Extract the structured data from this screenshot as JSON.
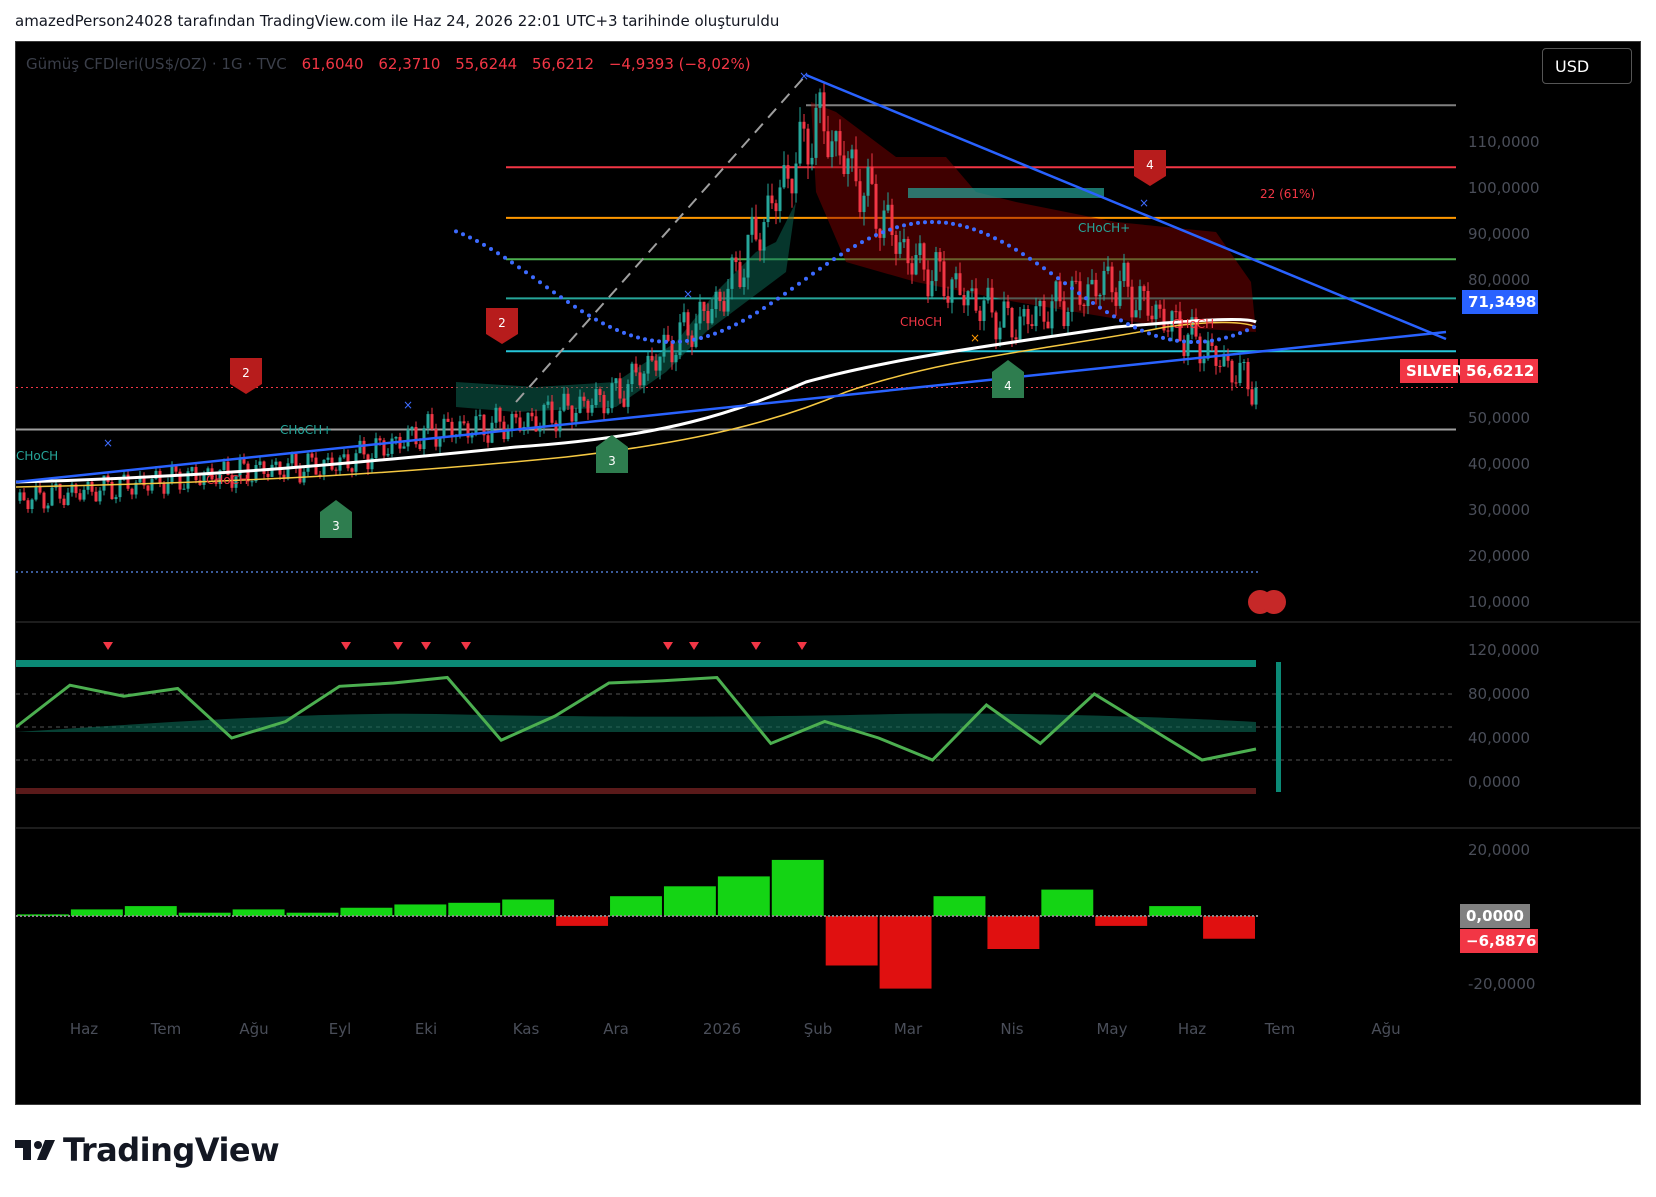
{
  "caption": "amazedPerson24028 tarafından TradingView.com ile Haz 24, 2026 22:01 UTC+3 tarihinde oluşturuldu",
  "legend": {
    "symbol": "Gümüş CFDleri(US$/OZ) · 1G · TVC",
    "open": "61,6040",
    "high": "62,3710",
    "low": "55,6244",
    "close": "56,6212",
    "change": "−4,9393 (−8,02%)"
  },
  "currency_button": "USD",
  "price_tags": {
    "level": "71,3498",
    "symbol_name": "SILVER",
    "last": "56,6212",
    "macd_zero": "0,0000",
    "macd_value": "−6,8876"
  },
  "colors": {
    "bull": "#26a69a",
    "bear": "#f23645",
    "trend_blue": "#2962ff",
    "ma_white": "#ffffff",
    "ma_yellow": "#f5c842",
    "hist_green": "#14d414",
    "hist_red": "#e01010",
    "bg": "#000000"
  },
  "annotations": {
    "choch_labels": [
      "CHoCH",
      "CHoCH+",
      "CHoCH",
      "CHoCH",
      "CHoCH+",
      "CHoCH"
    ],
    "wave_labels": [
      "2",
      "2",
      "3",
      "3",
      "4",
      "4"
    ],
    "fib_note": "22 (61%)"
  },
  "chart_data": [
    {
      "type": "candlestick",
      "title": "Gümüş CFDleri(US$/OZ) · 1G · TVC",
      "x_tick_labels": [
        "Haz",
        "Tem",
        "Ağu",
        "Eyl",
        "Eki",
        "Kas",
        "Ara",
        "2026",
        "Şub",
        "Mar",
        "Nis",
        "May",
        "Haz",
        "Tem",
        "Ağu"
      ],
      "y_tick_labels": [
        "110,0000",
        "100,0000",
        "90,0000",
        "80,0000",
        "60,0000",
        "50,0000",
        "40,0000",
        "30,0000",
        "20,0000",
        "10,0000"
      ],
      "ylim": [
        5,
        120
      ],
      "horizontal_levels": [
        {
          "value": 118,
          "color": "#808080"
        },
        {
          "value": 104.5,
          "color": "#f23645"
        },
        {
          "value": 93.5,
          "color": "#ff9800"
        },
        {
          "value": 84.5,
          "color": "#4caf50"
        },
        {
          "value": 76,
          "color": "#26a69a"
        },
        {
          "value": 64.5,
          "color": "#26c6da"
        },
        {
          "value": 47.5,
          "color": "#9e9e9e"
        }
      ],
      "close_series": [
        {
          "x": "Haz",
          "y": 32
        },
        {
          "x": "Tem",
          "y": 36.5
        },
        {
          "x": "Ağu",
          "y": 38.5
        },
        {
          "x": "Eyl",
          "y": 40
        },
        {
          "x": "Eki",
          "y": 47
        },
        {
          "x": "Kas",
          "y": 49
        },
        {
          "x": "Ara",
          "y": 55
        },
        {
          "x": "2026",
          "y": 76
        },
        {
          "x": "Şub",
          "y": 115
        },
        {
          "x": "Mar",
          "y": 85
        },
        {
          "x": "Nis",
          "y": 70
        },
        {
          "x": "May",
          "y": 80
        },
        {
          "x": "Haz",
          "y": 56.6212
        }
      ],
      "last_price": 56.6212
    },
    {
      "type": "line",
      "title": "",
      "y_tick_labels": [
        "120,0000",
        "80,0000",
        "40,0000",
        "0,0000"
      ],
      "ylim": [
        -10,
        130
      ],
      "reference_lines": [
        80,
        50,
        20
      ],
      "series": [
        {
          "values": [
            50,
            88,
            78,
            85,
            40,
            55,
            87,
            90,
            95,
            38,
            60,
            90,
            92,
            95,
            35,
            55,
            40,
            20,
            70,
            35,
            80,
            50,
            20,
            30
          ]
        }
      ]
    },
    {
      "type": "bar",
      "title": "",
      "y_tick_labels": [
        "20,0000",
        "0,0000",
        "-20,0000"
      ],
      "ylim": [
        -25,
        22
      ],
      "values": [
        0.5,
        2,
        3,
        1,
        2,
        1,
        2.5,
        3.5,
        4,
        5,
        -3,
        6,
        9,
        12,
        17,
        -15,
        -22,
        6,
        -10,
        8,
        -3,
        3,
        -6.8876
      ],
      "last_value": -6.8876
    }
  ]
}
